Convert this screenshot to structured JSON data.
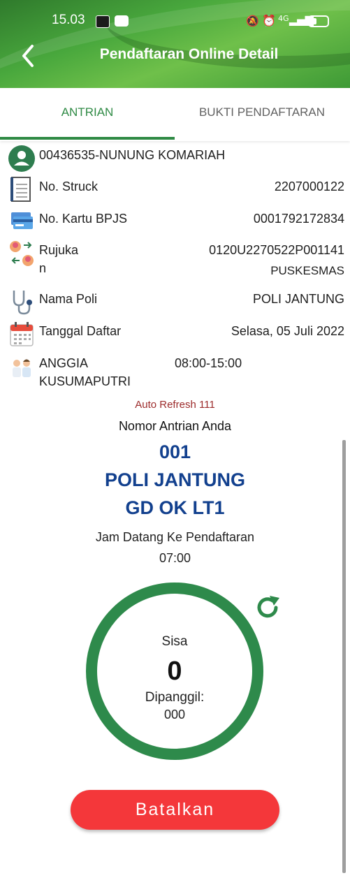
{
  "status_bar": {
    "time": "15.03",
    "network": "4G"
  },
  "header": {
    "title": "Pendaftaran Online Detail"
  },
  "tabs": [
    {
      "label": "ANTRIAN",
      "active": true
    },
    {
      "label": "BUKTI PENDAFTARAN",
      "active": false
    }
  ],
  "details": {
    "patient": "00436535-NUNUNG KOMARIAH",
    "struck": {
      "label": "No. Struck",
      "value": "2207000122"
    },
    "bpjs": {
      "label": "No. Kartu BPJS",
      "value": "0001792172834"
    },
    "rujukan": {
      "label_line1": "Rujuka",
      "label_line2": "n",
      "value_line1": "0120U2270522P001141",
      "value_line2": "PUSKESMAS"
    },
    "poli": {
      "label": "Nama Poli",
      "value": "POLI JANTUNG"
    },
    "tanggal": {
      "label": "Tanggal Daftar",
      "value": "Selasa, 05 Juli 2022"
    },
    "dokter": {
      "name_line1": "ANGGIA",
      "name_line2": "KUSUMAPUTRI",
      "jam": "08:00-15:00"
    }
  },
  "queue": {
    "auto_refresh": "Auto Refresh 111",
    "nomor_label": "Nomor Antrian Anda",
    "number": "001",
    "poli": "POLI JANTUNG",
    "gedung": "GD OK LT1",
    "jam_label": "Jam Datang Ke Pendaftaran",
    "jam_value": "07:00"
  },
  "counter": {
    "sisa_label": "Sisa",
    "sisa_value": "0",
    "dipanggil_label": "Dipanggil:",
    "dipanggil_value": "000"
  },
  "actions": {
    "cancel_label": "Batalkan"
  },
  "colors": {
    "accent": "#2f8a45",
    "queue_text": "#12408e",
    "danger": "#f4373a",
    "refresh_text": "#9c2a2a"
  }
}
